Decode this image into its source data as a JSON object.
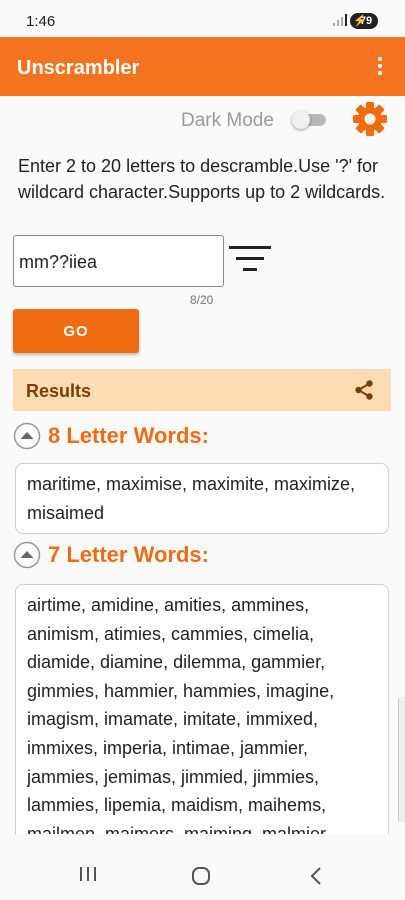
{
  "status_bar": {
    "time": "1:46",
    "battery": "79"
  },
  "app_bar": {
    "title": "Unscrambler"
  },
  "settings": {
    "dark_mode_label": "Dark Mode",
    "dark_mode_on": false
  },
  "instructions": "Enter 2 to 20 letters to descramble.Use '?' for wildcard character.Supports up to 2 wildcards.",
  "input": {
    "value": "mm??iiea",
    "char_count": "8/20"
  },
  "go_label": "GO",
  "results": {
    "label": "Results",
    "sections": [
      {
        "title": "8 Letter Words:",
        "words": "maritime, maximise, maximite, maximize, misaimed"
      },
      {
        "title": "7 Letter Words:",
        "words": "airtime, amidine, amities, ammines, animism, atimies, cammies, cimelia, diamide, diamine, dilemma, gammier, gimmies, hammier, hammies, imagine, imagism, imamate, imitate, immixed, immixes, imperia, intimae, jammier, jammies, jemimas, jimmied, jimmies, lammies, lipemia, maidism, maihems, mailmen, maimers, maiming, malmier"
      }
    ]
  },
  "colors": {
    "accent": "#f47320",
    "results_bg": "#fcdcb3",
    "section_title": "#ef6c15"
  }
}
